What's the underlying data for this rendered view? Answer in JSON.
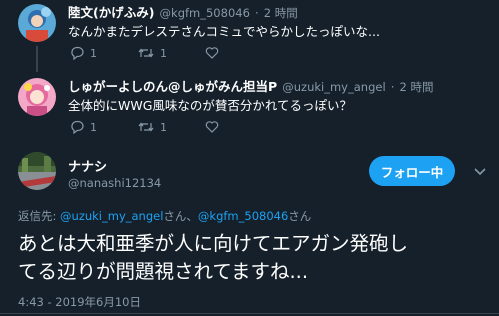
{
  "tweets": [
    {
      "name": "陸文(かげふみ)",
      "handle": "@kgfm_508046",
      "dot": "·",
      "time": "2 時間",
      "text": "なんかまたデレステさんコミュでやらかしたっぽいな...",
      "reply_count": "1",
      "retweet_count": "1",
      "like_count": ""
    },
    {
      "name": "しゅがーよしのん@しゅがみん担当P",
      "handle": "@uzuki_my_angel",
      "dot": "·",
      "time": "2 時間",
      "text": "全体的にWWG風味なのが賛否分かれてるっぽい？",
      "reply_count": "1",
      "retweet_count": "1",
      "like_count": ""
    }
  ],
  "main_tweet": {
    "name": "ナナシ",
    "handle": "@nanashi12134",
    "follow_label": "フォロー中",
    "reply_prefix": "返信先: ",
    "reply_user1": "@uzuki_my_angel",
    "reply_san1": "さん、",
    "reply_user2": "@kgfm_508046",
    "reply_san2": "さん",
    "text_line1": "あとは大和亜季が人に向けてエアガン発砲し",
    "text_line2": "てる辺りが問題視されてますね...",
    "timestamp": "4:43 - 2019年6月10日"
  },
  "colors": {
    "background": "#15202b",
    "accent": "#1da1f2",
    "secondary_text": "#8899a6",
    "divider": "#38444d"
  },
  "icons": [
    "reply-icon",
    "retweet-icon",
    "like-icon",
    "chevron-down-icon"
  ]
}
